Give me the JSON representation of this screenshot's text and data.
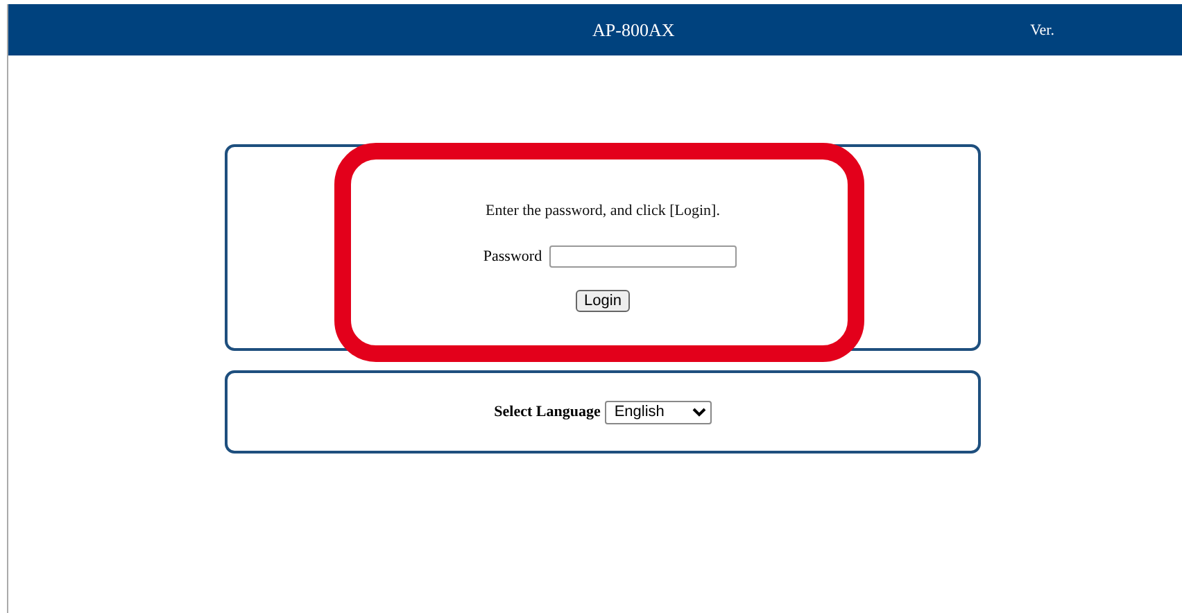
{
  "header": {
    "title": "AP-800AX",
    "version_label": "Ver."
  },
  "login_panel": {
    "instruction": "Enter the password, and click [Login].",
    "password_label": "Password",
    "login_button": "Login",
    "highlighted": true
  },
  "language_panel": {
    "label": "Select Language",
    "selected_language": "English"
  }
}
